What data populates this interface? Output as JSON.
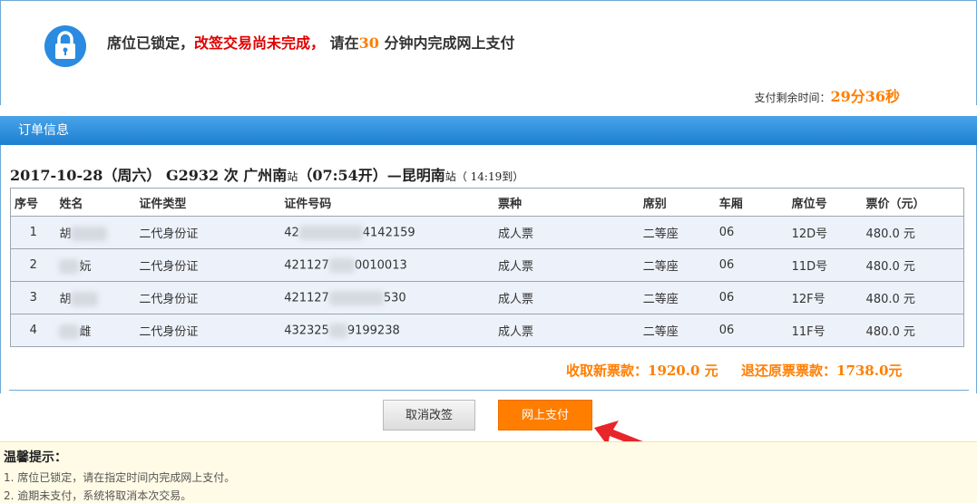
{
  "lock": {
    "message_prefix": "席位已锁定，",
    "message_red": "改签交易尚未完成，",
    "message_mid": "请在",
    "minutes": "30",
    "message_suffix": "分钟内完成网上支付"
  },
  "timer": {
    "label": "支付剩余时间：",
    "value": "29分36秒"
  },
  "order": {
    "section_title": "订单信息",
    "route": {
      "date": "2017-10-28（周六）",
      "train": "G2932 次",
      "from": "广州南",
      "station_suffix": "站",
      "depart": "（07:54开）—",
      "to": "昆明南",
      "arrive": "（ 14:19到）"
    },
    "columns": [
      "序号",
      "姓名",
      "证件类型",
      "证件号码",
      "票种",
      "席别",
      "车厢",
      "席位号",
      "票价（元）"
    ],
    "rows": [
      {
        "no": "1",
        "name": "胡",
        "id_type": "二代身份证",
        "id_prefix": "42",
        "id_suffix": "4142159",
        "ticket_type": "成人票",
        "seat_class": "二等座",
        "car": "06",
        "seat": "12D号",
        "price": "480.0 元"
      },
      {
        "no": "2",
        "name": "妧",
        "id_type": "二代身份证",
        "id_prefix": "421127",
        "id_suffix": "0010013",
        "ticket_type": "成人票",
        "seat_class": "二等座",
        "car": "06",
        "seat": "11D号",
        "price": "480.0 元"
      },
      {
        "no": "3",
        "name": "胡",
        "id_type": "二代身份证",
        "id_prefix": "421127",
        "id_suffix": "530",
        "ticket_type": "成人票",
        "seat_class": "二等座",
        "car": "06",
        "seat": "12F号",
        "price": "480.0 元"
      },
      {
        "no": "4",
        "name": "雌",
        "id_type": "二代身份证",
        "id_prefix": "432325",
        "id_suffix": "9199238",
        "ticket_type": "成人票",
        "seat_class": "二等座",
        "car": "06",
        "seat": "11F号",
        "price": "480.0 元"
      }
    ],
    "new_fee": "收取新票款：1920.0 元",
    "refund_fee": "退还原票票款：1738.0元"
  },
  "buttons": {
    "cancel": "取消改签",
    "pay": "网上支付"
  },
  "tips": {
    "title": "温馨提示：",
    "items": [
      "1. 席位已锁定，请在指定时间内完成网上支付。",
      "2. 逾期未支付，系统将取消本次交易。"
    ]
  },
  "colors": {
    "accent": "#1b7fd1",
    "orange": "#ff7e00",
    "red": "#e00000",
    "arrow": "#e8252a"
  },
  "icons": {
    "lock": "padlock-icon"
  }
}
